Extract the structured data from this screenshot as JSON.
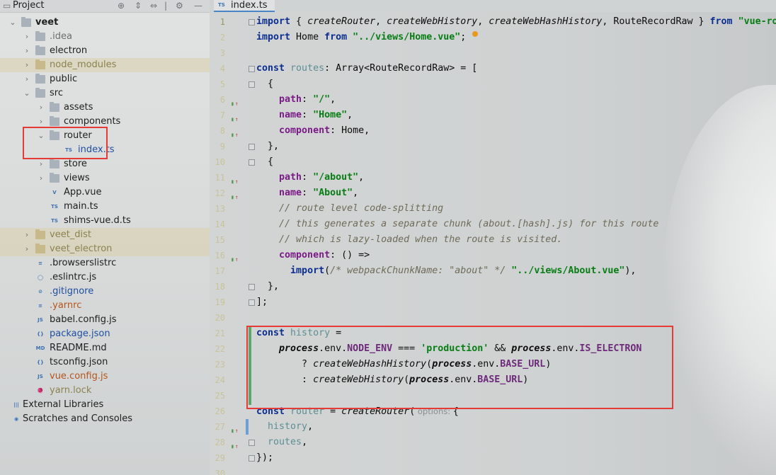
{
  "project_panel": {
    "title": "Project",
    "tree": [
      {
        "label": "veet",
        "level": 0,
        "kind": "root",
        "expanded": true,
        "bold": true
      },
      {
        "label": ".idea",
        "level": 1,
        "kind": "folder",
        "expanded": false,
        "color": "#6d6d6d"
      },
      {
        "label": "electron",
        "level": 1,
        "kind": "folder",
        "expanded": false
      },
      {
        "label": "node_modules",
        "level": 1,
        "kind": "folder",
        "expanded": false,
        "color": "#8c8250",
        "excluded": true
      },
      {
        "label": "public",
        "level": 1,
        "kind": "folder",
        "expanded": false
      },
      {
        "label": "src",
        "level": 1,
        "kind": "folder",
        "expanded": true
      },
      {
        "label": "assets",
        "level": 2,
        "kind": "folder",
        "expanded": false
      },
      {
        "label": "components",
        "level": 2,
        "kind": "folder",
        "expanded": false
      },
      {
        "label": "router",
        "level": 2,
        "kind": "folder",
        "expanded": true
      },
      {
        "label": "index.ts",
        "level": 3,
        "kind": "file",
        "file_type": "TS",
        "color": "#1f4ea1"
      },
      {
        "label": "store",
        "level": 2,
        "kind": "folder",
        "expanded": false
      },
      {
        "label": "views",
        "level": 2,
        "kind": "folder",
        "expanded": false
      },
      {
        "label": "App.vue",
        "level": 2,
        "kind": "file",
        "file_type": "V"
      },
      {
        "label": "main.ts",
        "level": 2,
        "kind": "file",
        "file_type": "TS"
      },
      {
        "label": "shims-vue.d.ts",
        "level": 2,
        "kind": "file",
        "file_type": "TS"
      },
      {
        "label": "veet_dist",
        "level": 1,
        "kind": "folder",
        "expanded": false,
        "color": "#8c8250",
        "excluded": true
      },
      {
        "label": "veet_electron",
        "level": 1,
        "kind": "folder",
        "expanded": false,
        "color": "#8c8250",
        "excluded": true
      },
      {
        "label": ".browserslistrc",
        "level": 1,
        "kind": "file",
        "file_type": "≡"
      },
      {
        "label": ".eslintrc.js",
        "level": 1,
        "kind": "file",
        "file_type": "◯"
      },
      {
        "label": ".gitignore",
        "level": 1,
        "kind": "file",
        "file_type": "⊘",
        "color": "#1f4ea1"
      },
      {
        "label": ".yarnrc",
        "level": 1,
        "kind": "file",
        "file_type": "≡",
        "color": "#b4561a"
      },
      {
        "label": "babel.config.js",
        "level": 1,
        "kind": "file",
        "file_type": "JS"
      },
      {
        "label": "package.json",
        "level": 1,
        "kind": "file",
        "file_type": "{}",
        "color": "#1f4ea1"
      },
      {
        "label": "README.md",
        "level": 1,
        "kind": "file",
        "file_type": "MD"
      },
      {
        "label": "tsconfig.json",
        "level": 1,
        "kind": "file",
        "file_type": "{}"
      },
      {
        "label": "vue.config.js",
        "level": 1,
        "kind": "file",
        "file_type": "JS",
        "color": "#b4561a"
      },
      {
        "label": "yarn.lock",
        "level": 1,
        "kind": "file",
        "file_type": "🧶",
        "color": "#8c8250"
      },
      {
        "label": "External Libraries",
        "level": 0,
        "kind": "library"
      },
      {
        "label": "Scratches and Consoles",
        "level": 0,
        "kind": "scratch"
      }
    ]
  },
  "editor": {
    "tab_label": "index.ts",
    "tab_badge": "TS",
    "gutter_mark": "▮",
    "line_numbers": [
      "1",
      "2",
      "3",
      "4",
      "5",
      "6",
      "7",
      "8",
      "9",
      "10",
      "11",
      "12",
      "13",
      "14",
      "15",
      "16",
      "17",
      "18",
      "19",
      "20",
      "21",
      "22",
      "23",
      "24",
      "25",
      "26",
      "27",
      "28",
      "29",
      "30"
    ],
    "lines": [
      [
        "import",
        " { ",
        "createRouter",
        ", ",
        "createWebHistory",
        ", ",
        "createWebHashHistory",
        ", ",
        "RouteRecordRaw",
        " } ",
        "from",
        " ",
        "\"vue-router\""
      ],
      [
        "import",
        " Home ",
        "from",
        " ",
        "\"../views/Home.vue\"",
        ";"
      ],
      [
        ""
      ],
      [
        "const",
        " ",
        "routes",
        ": Array<RouteRecordRaw> = ["
      ],
      [
        "  {"
      ],
      [
        "    ",
        "path",
        ": ",
        "\"/\"",
        ","
      ],
      [
        "    ",
        "name",
        ": ",
        "\"Home\"",
        ","
      ],
      [
        "    ",
        "component",
        ": Home,"
      ],
      [
        "  },"
      ],
      [
        "  {"
      ],
      [
        "    ",
        "path",
        ": ",
        "\"/about\"",
        ","
      ],
      [
        "    ",
        "name",
        ": ",
        "\"About\"",
        ","
      ],
      [
        "    ",
        "// route level code-splitting"
      ],
      [
        "    ",
        "// this generates a separate chunk (about.[hash].js) for this route"
      ],
      [
        "    ",
        "// which is lazy-loaded when the route is visited."
      ],
      [
        "    ",
        "component",
        ": () =>"
      ],
      [
        "      ",
        "import",
        "(",
        "/* webpackChunkName: \"about\" */",
        " ",
        "\"../views/About.vue\"",
        "),"
      ],
      [
        "  },"
      ],
      [
        "];"
      ],
      [
        ""
      ],
      [
        "const",
        " ",
        "history",
        " ="
      ],
      [
        "    ",
        "process",
        ".env.",
        "NODE_ENV",
        " === ",
        "'production'",
        " && ",
        "process",
        ".env.",
        "IS_ELECTRON"
      ],
      [
        "        ? ",
        "createWebHashHistory",
        "(",
        "process",
        ".env.",
        "BASE_URL",
        ")"
      ],
      [
        "        : ",
        "createWebHistory",
        "(",
        "process",
        ".env.",
        "BASE_URL",
        ")"
      ],
      [
        ""
      ],
      [
        "const",
        " ",
        "router",
        " = ",
        "createRouter",
        "(",
        " options: ",
        "{"
      ],
      [
        "  ",
        "history",
        ","
      ],
      [
        "  ",
        "routes",
        ","
      ],
      [
        "});"
      ],
      [
        ""
      ]
    ]
  },
  "colors": {
    "annotation_box": "#e53a35",
    "modified_bar": "#59a869",
    "tab_underline": "#4a86c7"
  },
  "icons": [
    "project-view-icon",
    "locate-icon",
    "collapse-icon",
    "expand-icon",
    "settings-icon",
    "minimize-icon"
  ]
}
